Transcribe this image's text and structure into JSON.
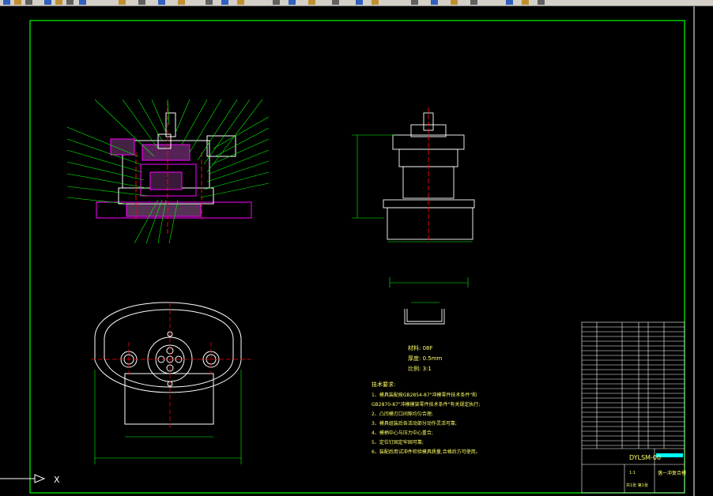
{
  "toolbar": {
    "icons": [
      "open-icon",
      "save-icon",
      "print-icon",
      "undo-icon",
      "redo-icon",
      "pan-icon",
      "zoom-icon",
      "properties-icon",
      "layer-icon",
      "match-icon"
    ]
  },
  "drawing": {
    "notes": {
      "material": "材料: 08F",
      "thickness": "厚度: 0.5mm",
      "ratio": "比例: 3:1",
      "tech_title": "技术要求:",
      "tech_lines": [
        "1、模具装配按GB2854-87\"冲模零件技术条件\"和",
        "GB2870-87\"冲模模架零件技术条件\"有关规定执行;",
        "2、凸凹模刃口间隙均匀合理;",
        "3、模具组装后各活动部分动作灵活可靠;",
        "4、模柄中心与压力中心重合;",
        "5、定位钉固定牢固可靠;",
        "6、装配后用试冲件检验模具质量,合格后方可使用。"
      ]
    },
    "title_block": {
      "drawing_no": "DYLSM-00",
      "drawing_name": "落一冲复合模",
      "scale": "1:1",
      "sheet": "共1张 第1张"
    },
    "ucs": {
      "x_label": "X"
    }
  },
  "colors": {
    "background": "#000000",
    "border": "#00ff00",
    "part_lines": "#ffffff",
    "dimensions": "#00ff00",
    "centerlines": "#ff0000",
    "hatch": "#ff00ff"
  }
}
